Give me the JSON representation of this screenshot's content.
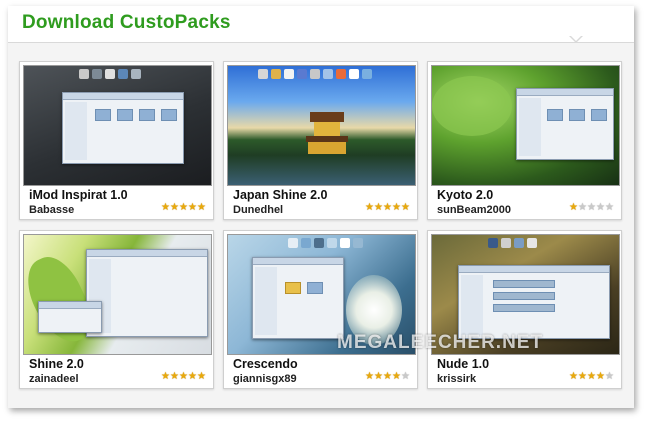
{
  "header": {
    "title": "Download CustoPacks"
  },
  "packs": [
    {
      "name": "iMod Inspirat 1.0",
      "author": "Babasse",
      "rating": 5
    },
    {
      "name": "Japan Shine 2.0",
      "author": "Dunedhel",
      "rating": 5
    },
    {
      "name": "Kyoto 2.0",
      "author": "sunBeam2000",
      "rating": 1
    },
    {
      "name": "Shine 2.0",
      "author": "zainadeel",
      "rating": 5
    },
    {
      "name": "Crescendo",
      "author": "giannisgx89",
      "rating": 4
    },
    {
      "name": "Nude 1.0",
      "author": "krissirk",
      "rating": 4
    }
  ],
  "rating_max": 5,
  "watermark": "MEGALEECHER.NET",
  "colors": {
    "title": "#2f9c1f",
    "star_on": "#e8a90c",
    "star_off": "#c9c9c9"
  }
}
